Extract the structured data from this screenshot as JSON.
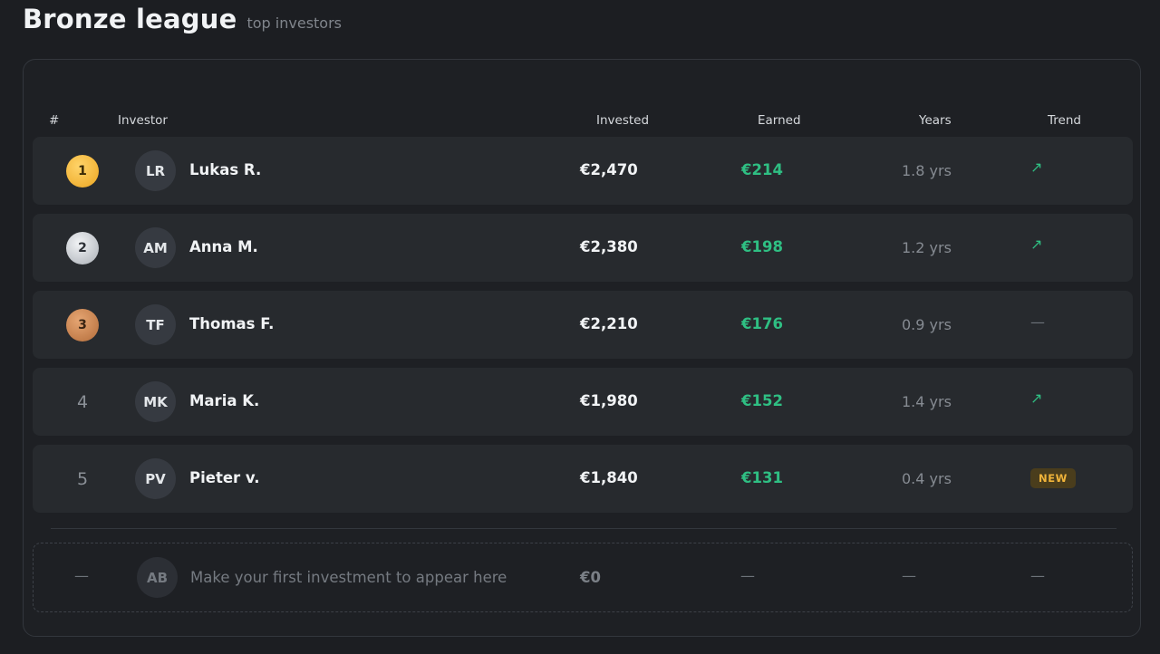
{
  "header": {
    "title": "Bronze league",
    "subtitle": "top investors"
  },
  "table": {
    "columns": {
      "rank": "#",
      "investor": "Investor",
      "invested": "Invested",
      "earned": "Earned",
      "years": "Years",
      "trend": "Trend"
    },
    "rows": [
      {
        "rank": "1",
        "medal": "gold",
        "initials": "LR",
        "name": "Lukas R.",
        "invested": "€2,470",
        "earned": "€214",
        "years": "1.8 yrs",
        "trend": "↗",
        "trend_icon": "arrow-up-right-icon"
      },
      {
        "rank": "2",
        "medal": "silver",
        "initials": "AM",
        "name": "Anna M.",
        "invested": "€2,380",
        "earned": "€198",
        "years": "1.2 yrs",
        "trend": "↗",
        "trend_icon": "arrow-up-right-icon"
      },
      {
        "rank": "3",
        "medal": "bronze",
        "initials": "TF",
        "name": "Thomas F.",
        "invested": "€2,210",
        "earned": "€176",
        "years": "0.9 yrs",
        "trend": "—",
        "trend_icon": "dash-icon"
      },
      {
        "rank": "4",
        "medal": "none",
        "initials": "MK",
        "name": "Maria K.",
        "invested": "€1,980",
        "earned": "€152",
        "years": "1.4 yrs",
        "trend": "↗",
        "trend_icon": "arrow-up-right-icon"
      },
      {
        "rank": "5",
        "medal": "none",
        "initials": "PV",
        "name": "Pieter v.",
        "invested": "€1,840",
        "earned": "€131",
        "years": "0.4 yrs",
        "trend": "NEW",
        "trend_icon": "new-badge"
      }
    ],
    "placeholder": {
      "rank": "—",
      "initials": "AB",
      "text": "Make your first investment to appear here",
      "invested": "€0",
      "earned": "—",
      "years": "—",
      "trend": "—"
    }
  },
  "colors": {
    "background": "#1c1e22",
    "row": "#272a2e",
    "accent_green": "#2fbf83",
    "gold": "#f5b73a",
    "silver": "#c9cdd2",
    "bronze": "#cc8650",
    "new_badge": "#f0b43a"
  }
}
